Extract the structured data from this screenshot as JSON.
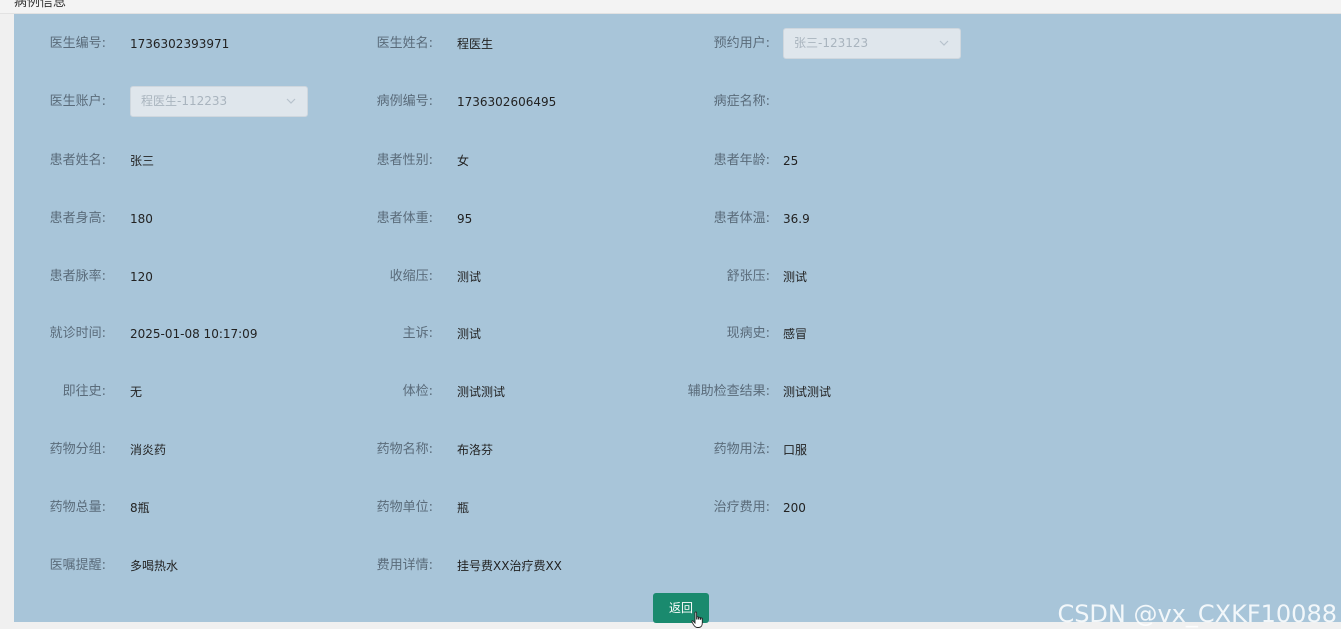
{
  "page": {
    "title": "病例信息"
  },
  "form": {
    "rows": [
      [
        {
          "label": "医生编号:",
          "value": "1736302393971"
        },
        {
          "label": "医生姓名:",
          "value": "程医生"
        },
        {
          "label": "预约用户:",
          "select": "张三-123123"
        }
      ],
      [
        {
          "label": "医生账户:",
          "select": "程医生-112233"
        },
        {
          "label": "病例编号:",
          "value": "1736302606495"
        },
        {
          "label": "病症名称:",
          "value": ""
        }
      ],
      [
        {
          "label": "患者姓名:",
          "value": "张三"
        },
        {
          "label": "患者性别:",
          "value": "女"
        },
        {
          "label": "患者年龄:",
          "value": "25"
        }
      ],
      [
        {
          "label": "患者身高:",
          "value": "180"
        },
        {
          "label": "患者体重:",
          "value": "95"
        },
        {
          "label": "患者体温:",
          "value": "36.9"
        }
      ],
      [
        {
          "label": "患者脉率:",
          "value": "120"
        },
        {
          "label": "收缩压:",
          "value": "测试"
        },
        {
          "label": "舒张压:",
          "value": "测试"
        }
      ],
      [
        {
          "label": "就诊时间:",
          "value": "2025-01-08 10:17:09"
        },
        {
          "label": "主诉:",
          "value": "测试"
        },
        {
          "label": "现病史:",
          "value": "感冒"
        }
      ],
      [
        {
          "label": "即往史:",
          "value": "无"
        },
        {
          "label": "体检:",
          "value": "测试测试"
        },
        {
          "label": "辅助检查结果:",
          "value": "测试测试"
        }
      ],
      [
        {
          "label": "药物分组:",
          "value": "消炎药"
        },
        {
          "label": "药物名称:",
          "value": "布洛芬"
        },
        {
          "label": "药物用法:",
          "value": "口服"
        }
      ],
      [
        {
          "label": "药物总量:",
          "value": "8瓶"
        },
        {
          "label": "药物单位:",
          "value": "瓶"
        },
        {
          "label": "治疗费用:",
          "value": "200"
        }
      ],
      [
        {
          "label": "医嘱提醒:",
          "value": "多喝热水"
        },
        {
          "label": "费用详情:",
          "value": "挂号费XX治疗费XX"
        }
      ]
    ]
  },
  "actions": {
    "back_label": "返回"
  },
  "watermark": "CSDN @vx_CXKF10088",
  "colors": {
    "panel": "#a8c5d9",
    "button": "#1a8a6e"
  },
  "icons": {
    "select_chevron": "chevron-down-icon",
    "cursor": "hand-pointer-icon"
  }
}
